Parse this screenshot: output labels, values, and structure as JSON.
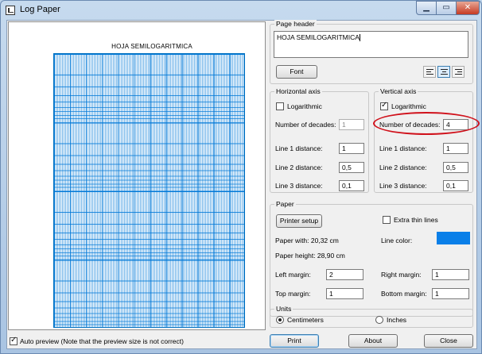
{
  "window": {
    "title": "Log Paper"
  },
  "titlebar": {
    "min_glyph": "▁",
    "max_glyph": "▭",
    "close_glyph": "✕"
  },
  "preview": {
    "title": "HOJA SEMILOGARITMICA"
  },
  "auto_preview": {
    "label": "Auto preview (Note that the preview size is not correct)",
    "checked": true
  },
  "page_header": {
    "group_title": "Page header",
    "text": "HOJA SEMILOGARITMICA",
    "font_button": "Font",
    "alignments": [
      "align-left",
      "align-center",
      "align-right"
    ],
    "active_alignment": "align-center"
  },
  "horizontal_axis": {
    "group_title": "Horizontal axis",
    "logarithmic_label": "Logarithmic",
    "logarithmic_checked": false,
    "decades_label": "Number of decades:",
    "decades_value": "1",
    "line1_label": "Line 1 distance:",
    "line1_value": "1",
    "line2_label": "Line 2 distance:",
    "line2_value": "0,5",
    "line3_label": "Line 3 distance:",
    "line3_value": "0,1"
  },
  "vertical_axis": {
    "group_title": "Vertical axis",
    "logarithmic_label": "Logarithmic",
    "logarithmic_checked": true,
    "decades_label": "Number of decades:",
    "decades_value": "4",
    "line1_label": "Line 1 distance:",
    "line1_value": "1",
    "line2_label": "Line 2 distance:",
    "line2_value": "0,5",
    "line3_label": "Line 3 distance:",
    "line3_value": "0,1"
  },
  "paper": {
    "group_title": "Paper",
    "printer_setup": "Printer setup",
    "extra_thin_label": "Extra thin lines",
    "extra_thin_checked": false,
    "width_text": "Paper with: 20,32 cm",
    "height_text": "Paper height: 28,90 cm",
    "line_color_label": "Line color:",
    "line_color": "#0a7fe8",
    "left_margin_label": "Left margin:",
    "left_margin_value": "2",
    "right_margin_label": "Right margin:",
    "right_margin_value": "1",
    "top_margin_label": "Top margin:",
    "top_margin_value": "1",
    "bottom_margin_label": "Bottom margin:",
    "bottom_margin_value": "1"
  },
  "units": {
    "group_title": "Units",
    "centimeters": "Centimeters",
    "inches": "Inches",
    "selected": "centimeters"
  },
  "buttons": {
    "print": "Print",
    "about": "About",
    "close": "Close"
  },
  "colors": {
    "grid_blue": "#0078d7",
    "highlight_red": "#d0111b"
  }
}
